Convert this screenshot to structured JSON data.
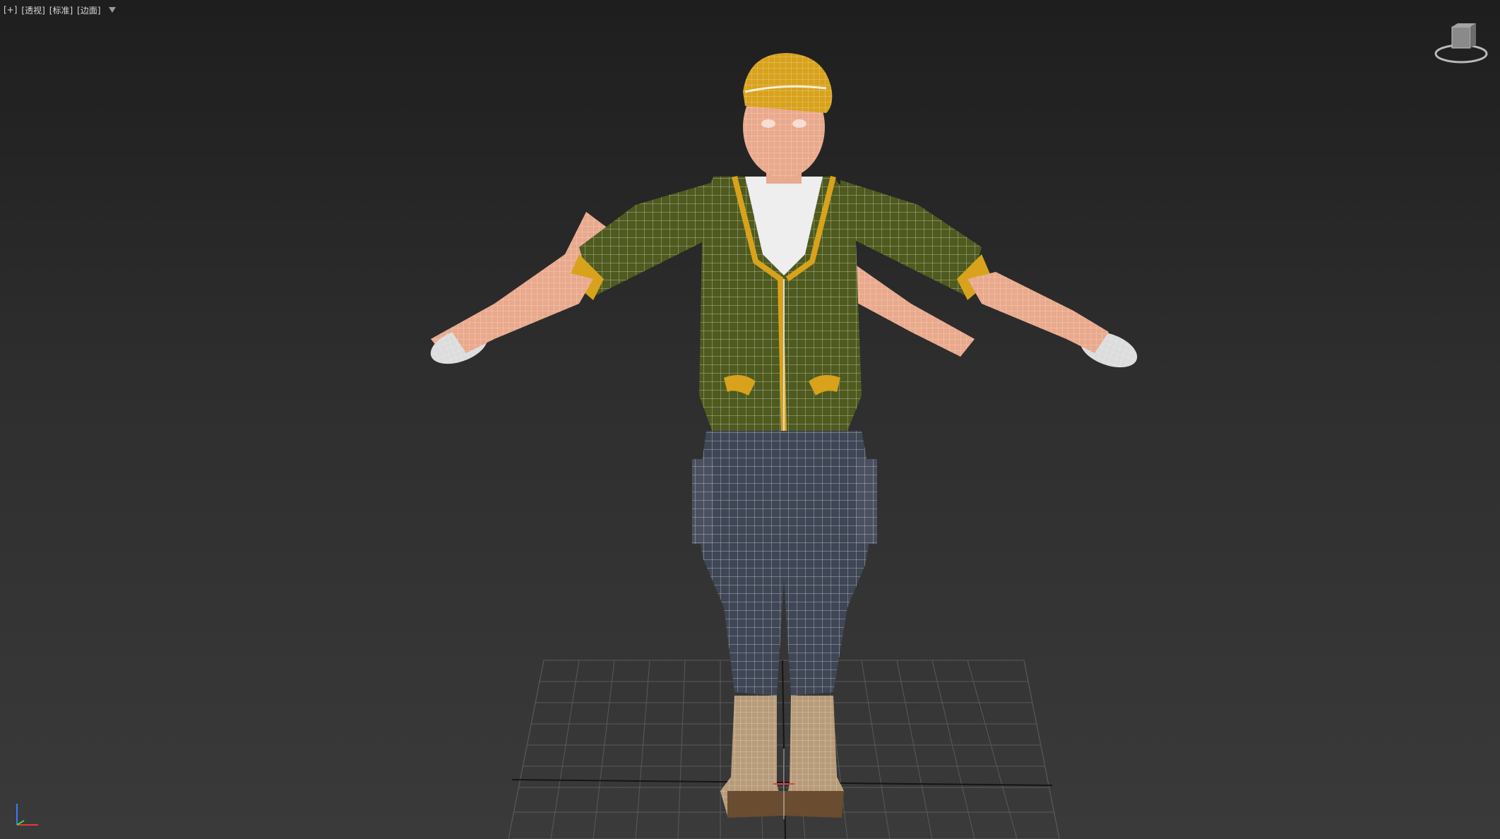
{
  "viewport": {
    "label_segments": [
      "[+]",
      "[透视]",
      "[标准]",
      "[边面]"
    ],
    "background_top": "#1e1e1e",
    "background_bottom": "#3a3a3a"
  },
  "scene": {
    "object": "character-model",
    "display_mode": "edged-faces",
    "colors": {
      "jacket": "#4e5a1e",
      "trim": "#d8a21c",
      "skin": "#e9a98c",
      "pants": "#3f4655",
      "boots": "#b89c7a",
      "cap": "#d8a21c",
      "wireframe": "#ffffff",
      "grid": "#6a6a6a"
    }
  },
  "icons": {
    "filter": "funnel-icon",
    "viewcube": "viewcube-icon",
    "axis": "axis-tripod-icon"
  }
}
